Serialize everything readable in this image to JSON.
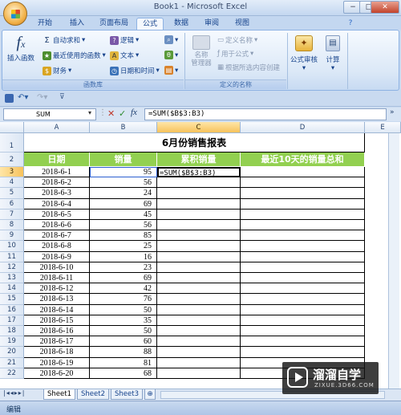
{
  "window": {
    "title": "Book1 - Microsoft Excel",
    "close": "✕",
    "minimize": "−",
    "maximize": "□"
  },
  "tabs": [
    "开始",
    "插入",
    "页面布局",
    "公式",
    "数据",
    "审阅",
    "视图"
  ],
  "active_tab": "公式",
  "ribbon": {
    "insert_function": "插入函数",
    "autosum": "自动求和",
    "recent": "最近使用的函数",
    "finance": "财务",
    "logic": "逻辑",
    "text": "文本",
    "datetime": "日期和时间",
    "group1": "函数库",
    "name_manager": "名称\n管理器",
    "define_name": "定义名称",
    "use_in_formula": "用于公式",
    "create_from_sel": "根据所选内容创建",
    "group2": "定义的名称",
    "formula_audit": "公式审核",
    "calculation": "计算"
  },
  "formula_bar": {
    "name_box": "SUM",
    "formula": "=SUM($B$3:B3)",
    "fx": "fx"
  },
  "columns": [
    "A",
    "B",
    "C",
    "D",
    "E"
  ],
  "sheet_title": "6月份销售报表",
  "headers": [
    "日期",
    "销量",
    "累积销量",
    "最近10天的销量总和"
  ],
  "rows": [
    {
      "date": "2018-6-1",
      "qty": "95"
    },
    {
      "date": "2018-6-2",
      "qty": "56"
    },
    {
      "date": "2018-6-3",
      "qty": "24"
    },
    {
      "date": "2018-6-4",
      "qty": "69"
    },
    {
      "date": "2018-6-5",
      "qty": "45"
    },
    {
      "date": "2018-6-6",
      "qty": "56"
    },
    {
      "date": "2018-6-7",
      "qty": "85"
    },
    {
      "date": "2018-6-8",
      "qty": "25"
    },
    {
      "date": "2018-6-9",
      "qty": "16"
    },
    {
      "date": "2018-6-10",
      "qty": "23"
    },
    {
      "date": "2018-6-11",
      "qty": "69"
    },
    {
      "date": "2018-6-12",
      "qty": "42"
    },
    {
      "date": "2018-6-13",
      "qty": "76"
    },
    {
      "date": "2018-6-14",
      "qty": "50"
    },
    {
      "date": "2018-6-15",
      "qty": "35"
    },
    {
      "date": "2018-6-16",
      "qty": "50"
    },
    {
      "date": "2018-6-17",
      "qty": "60"
    },
    {
      "date": "2018-6-18",
      "qty": "88"
    },
    {
      "date": "2018-6-19",
      "qty": "81"
    },
    {
      "date": "2018-6-20",
      "qty": "68"
    }
  ],
  "editing_cell": "=SUM($B$3:B3)",
  "sheets": [
    "Sheet1",
    "Sheet2",
    "Sheet3"
  ],
  "status": "编辑",
  "watermark": {
    "brand": "溜溜自学",
    "url": "ZIXUE.3D66.COM"
  }
}
